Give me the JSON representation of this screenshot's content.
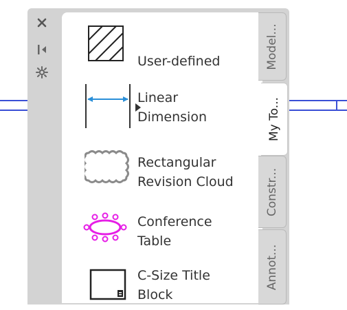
{
  "controls": {
    "close_icon": "close-icon",
    "auto_hide_icon": "auto-hide-icon",
    "properties_icon": "properties-icon"
  },
  "tools": [
    {
      "name": "user-defined",
      "label": "User-defined"
    },
    {
      "name": "linear-dimension",
      "label": "Linear\nDimension"
    },
    {
      "name": "rectangular-revision-cloud",
      "label": "Rectangular\nRevision Cloud"
    },
    {
      "name": "conference-table",
      "label": "Conference\nTable"
    },
    {
      "name": "c-size-title-block",
      "label": "C-Size Title\nBlock"
    }
  ],
  "tabs": [
    {
      "label": "Model...",
      "active": false
    },
    {
      "label": "My To...",
      "active": true
    },
    {
      "label": "Constr...",
      "active": false
    },
    {
      "label": "Annot...",
      "active": false
    }
  ],
  "colors": {
    "cad_line": "#3a4fd6",
    "dimension_blue": "#2a8fd8",
    "conference_magenta": "#e61ee6"
  }
}
